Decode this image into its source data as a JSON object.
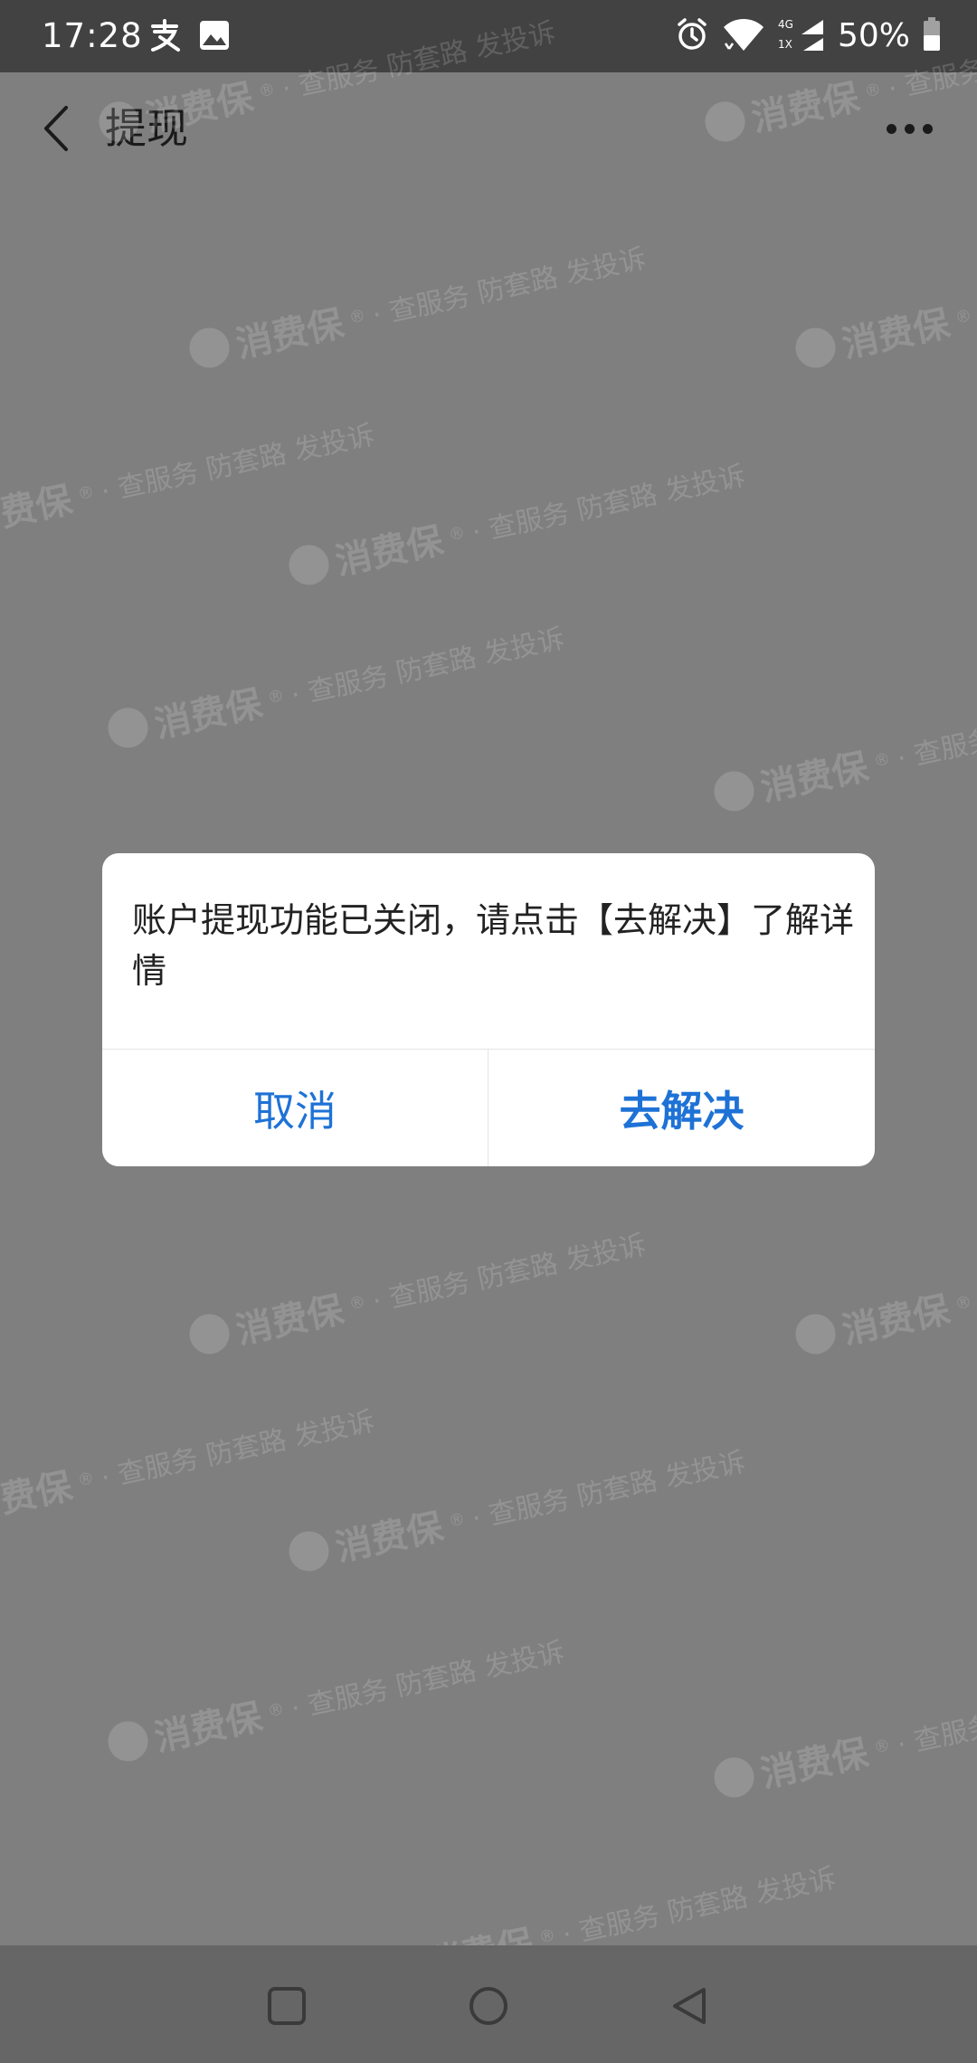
{
  "status_bar": {
    "time": "17:28",
    "left_icons": [
      "alipay-icon",
      "image-icon"
    ],
    "right_icons": [
      "alarm-icon",
      "wifi-icon",
      "cellular-signal-icon",
      "battery-icon"
    ],
    "network_labels": {
      "top": "4G",
      "bottom": "1X"
    },
    "battery_text": "50%"
  },
  "navbar": {
    "back_icon": "chevron-left-icon",
    "title": "提现",
    "more_icon": "more-dots-icon"
  },
  "watermark": {
    "brand": "消费保",
    "registered": "®",
    "slogan": "· 查服务 防套路 发投诉"
  },
  "dialog": {
    "message": "账户提现功能已关闭，请点击【去解决】了解详情",
    "cancel_label": "取消",
    "confirm_label": "去解决"
  },
  "system_nav": {
    "icons": [
      "recents-square-icon",
      "home-circle-icon",
      "back-triangle-icon"
    ]
  },
  "colors": {
    "overlay_bg": "#7f7f7f",
    "status_bar_bg": "#424242",
    "dialog_bg": "#ffffff",
    "accent_blue": "#1e72d6",
    "system_nav_bg": "#666666"
  }
}
